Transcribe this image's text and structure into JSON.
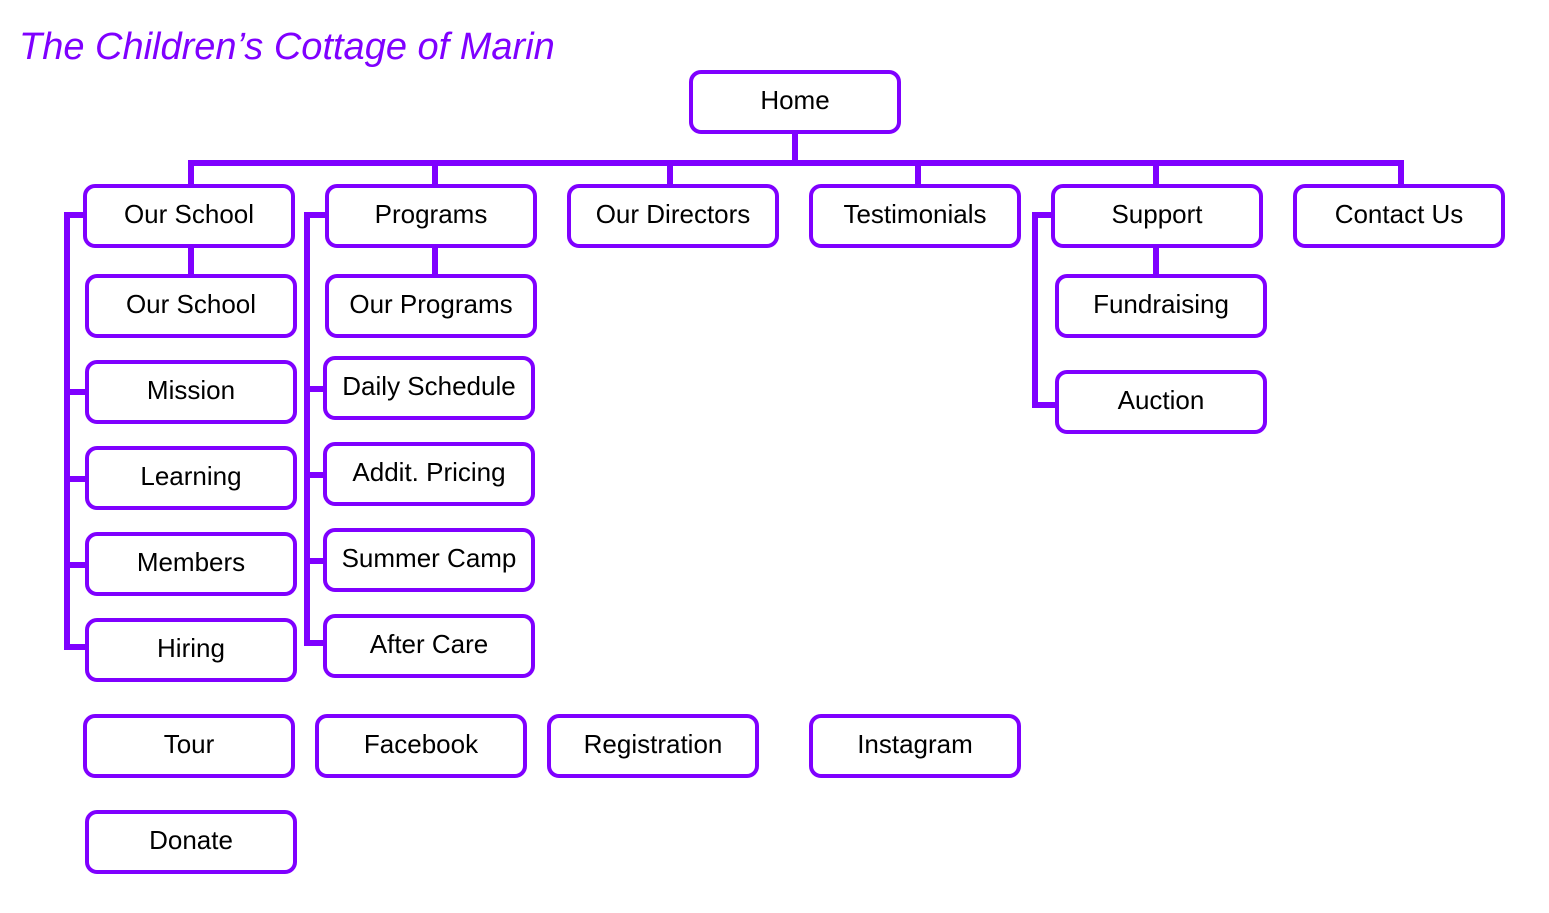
{
  "title": "The Children’s Cottage of Marin",
  "accent_color": "#7f00ff",
  "root": {
    "label": "Home"
  },
  "sections": [
    {
      "label": "Our School",
      "children": [
        "Our School",
        "Mission",
        "Learning",
        "Members",
        "Hiring"
      ]
    },
    {
      "label": "Programs",
      "children": [
        "Our Programs",
        "Daily Schedule",
        "Addit. Pricing",
        "Summer Camp",
        "After Care"
      ]
    },
    {
      "label": "Our Directors",
      "children": []
    },
    {
      "label": "Testimonials",
      "children": []
    },
    {
      "label": "Support",
      "children": [
        "Fundraising",
        "Auction"
      ]
    },
    {
      "label": "Contact Us",
      "children": []
    }
  ],
  "standalone": [
    "Tour",
    "Facebook",
    "Registration",
    "Instagram",
    "Donate"
  ]
}
